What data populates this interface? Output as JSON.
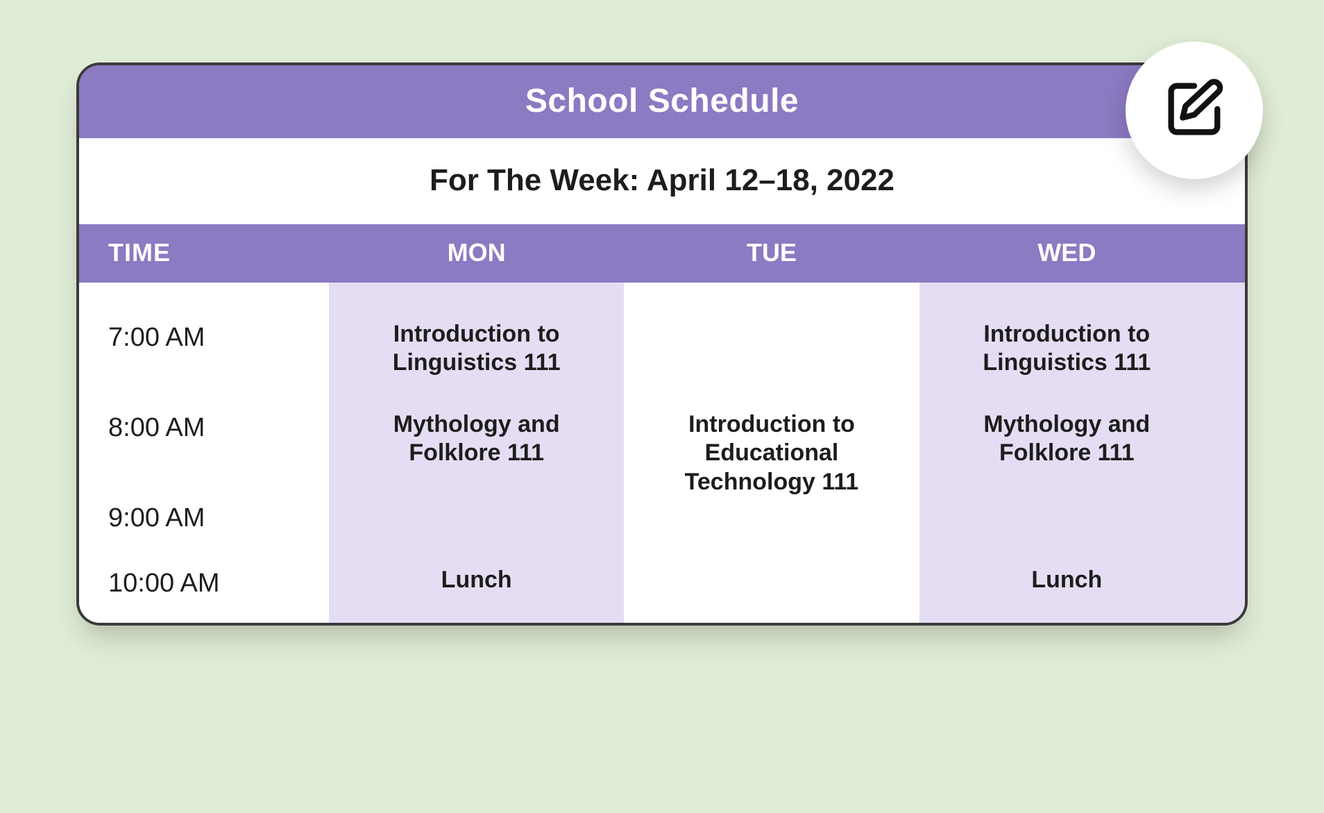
{
  "header": {
    "title": "School Schedule",
    "subtitle": "For The Week: April 12–18, 2022"
  },
  "columns": {
    "time": "TIME",
    "days": [
      "MON",
      "TUE",
      "WED"
    ]
  },
  "rows": [
    {
      "time": "7:00 AM",
      "cells": [
        "Introduction to Linguistics 111",
        "",
        "Introduction to Linguistics 111"
      ]
    },
    {
      "time": "8:00 AM",
      "cells": [
        "Mythology and Folklore 111",
        "Introduction to Educational Technology 111",
        "Mythology and Folklore 111"
      ]
    },
    {
      "time": "9:00 AM",
      "cells": [
        "",
        "",
        ""
      ]
    },
    {
      "time": "10:00 AM",
      "cells": [
        "Lunch",
        "",
        "Lunch"
      ]
    }
  ],
  "colors": {
    "accent": "#8c7ac2",
    "shaded": "#e5ddf3",
    "page_bg": "#e0edd6"
  },
  "icons": {
    "edit": "edit-icon"
  }
}
